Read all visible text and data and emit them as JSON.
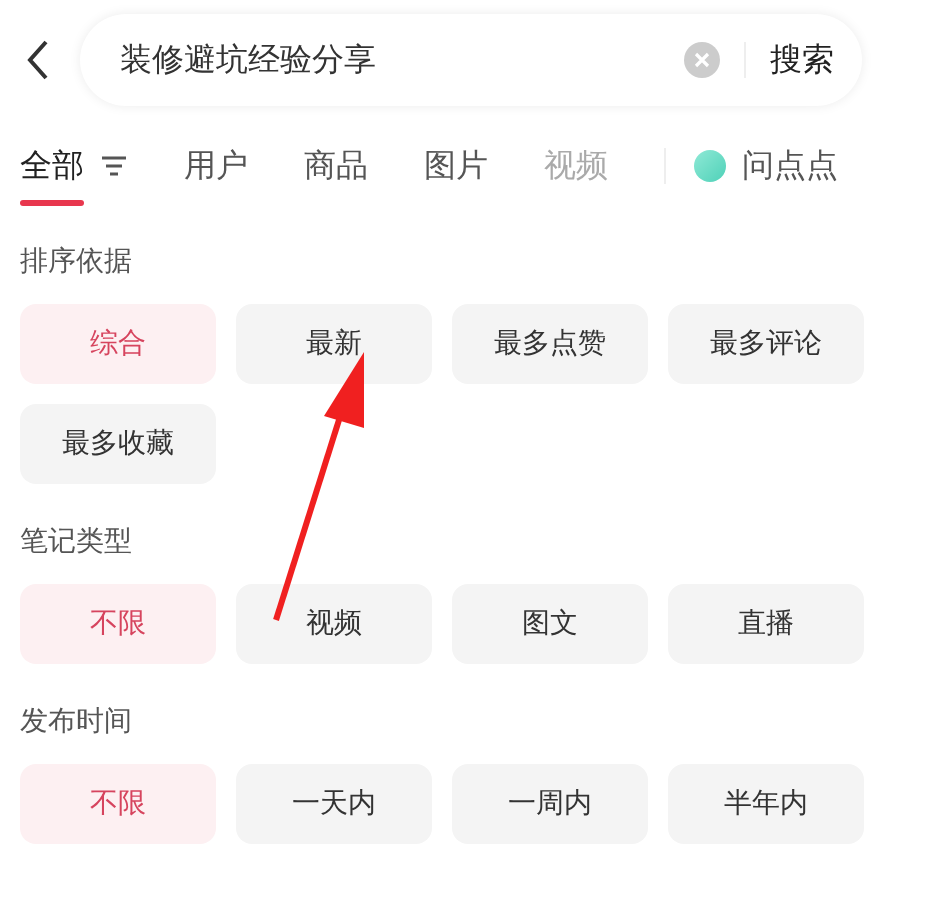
{
  "search": {
    "value": "装修避坑经验分享",
    "button": "搜索"
  },
  "tabs": [
    {
      "label": "全部",
      "selected": true,
      "kind": "filter"
    },
    {
      "label": "用户",
      "selected": false,
      "kind": "plain"
    },
    {
      "label": "商品",
      "selected": false,
      "kind": "plain"
    },
    {
      "label": "图片",
      "selected": false,
      "kind": "plain"
    },
    {
      "label": "视频",
      "selected": false,
      "kind": "faded"
    },
    {
      "label": "问点点",
      "selected": false,
      "kind": "bubble"
    }
  ],
  "sections": [
    {
      "title": "排序依据",
      "options": [
        {
          "label": "综合",
          "selected": true
        },
        {
          "label": "最新",
          "selected": false
        },
        {
          "label": "最多点赞",
          "selected": false
        },
        {
          "label": "最多评论",
          "selected": false
        },
        {
          "label": "最多收藏",
          "selected": false
        }
      ]
    },
    {
      "title": "笔记类型",
      "options": [
        {
          "label": "不限",
          "selected": true
        },
        {
          "label": "视频",
          "selected": false
        },
        {
          "label": "图文",
          "selected": false
        },
        {
          "label": "直播",
          "selected": false
        }
      ]
    },
    {
      "title": "发布时间",
      "options": [
        {
          "label": "不限",
          "selected": true
        },
        {
          "label": "一天内",
          "selected": false
        },
        {
          "label": "一周内",
          "selected": false
        },
        {
          "label": "半年内",
          "selected": false
        }
      ]
    }
  ]
}
